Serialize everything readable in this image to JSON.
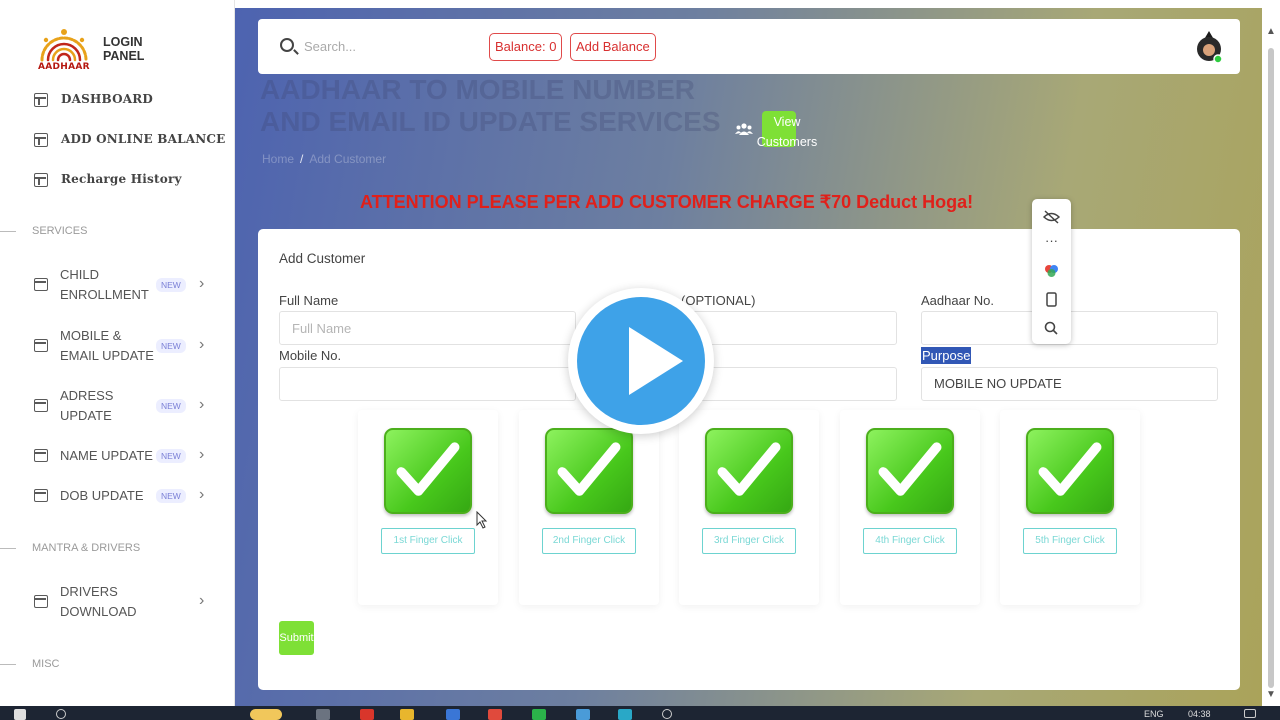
{
  "logo": {
    "word": "AADHAAR",
    "line1": "LOGIN",
    "line2": "PANEL"
  },
  "nav": [
    {
      "label": "DASHBOARD"
    },
    {
      "label": "ADD ONLINE BALANCE"
    },
    {
      "label": "Recharge History"
    }
  ],
  "sections": {
    "services": "SERVICES",
    "drivers": "MANTRA & DRIVERS",
    "misc": "MISC"
  },
  "services": [
    {
      "label": "CHILD ENROLLMENT",
      "badge": "NEW"
    },
    {
      "label": "MOBILE & EMAIL UPDATE",
      "badge": "NEW"
    },
    {
      "label": "ADRESS UPDATE",
      "badge": "NEW"
    },
    {
      "label": "NAME UPDATE",
      "badge": "NEW"
    },
    {
      "label": "DOB UPDATE",
      "badge": "NEW"
    }
  ],
  "drivers": [
    {
      "label": "DRIVERS DOWNLOAD"
    }
  ],
  "topbar": {
    "search_placeholder": "Search...",
    "balance": "Balance: 0",
    "add_balance": "Add Balance"
  },
  "hero": {
    "title": "AADHAAR TO MOBILE NUMBER AND EMAIL ID UPDATE SERVICES",
    "view_customers": "View Customers",
    "breadcrumb_home": "Home",
    "breadcrumb_sep": "/",
    "breadcrumb_current": "Add Customer"
  },
  "attention": "ATTENTION PLEASE PER ADD CUSTOMER CHARGE ₹70 Deduct Hoga!",
  "form": {
    "title": "Add Customer",
    "full_name_label": "Full Name",
    "full_name_placeholder": "Full Name",
    "email_label": "(OPTIONAL)",
    "aadhaar_label": "Aadhaar No.",
    "mobile_label": "Mobile No.",
    "purpose_label": "Purpose",
    "purpose_value": "MOBILE NO UPDATE",
    "submit": "Submit"
  },
  "fingers": [
    {
      "label": "1st Finger Click"
    },
    {
      "label": "2nd Finger Click"
    },
    {
      "label": "3rd Finger Click"
    },
    {
      "label": "4th Finger Click"
    },
    {
      "label": "5th Finger Click"
    }
  ],
  "floating_toolbar": [
    "hide-icon",
    "more-icon",
    "color-icon",
    "copy-icon",
    "search-icon"
  ],
  "taskbar": {
    "lang": "ENG",
    "time": "04:38"
  },
  "colors": {
    "accent_green": "#7ee036",
    "alert_red": "#e0201a",
    "play_blue": "#3ea2e8",
    "purpose_highlight": "#3157b5"
  }
}
